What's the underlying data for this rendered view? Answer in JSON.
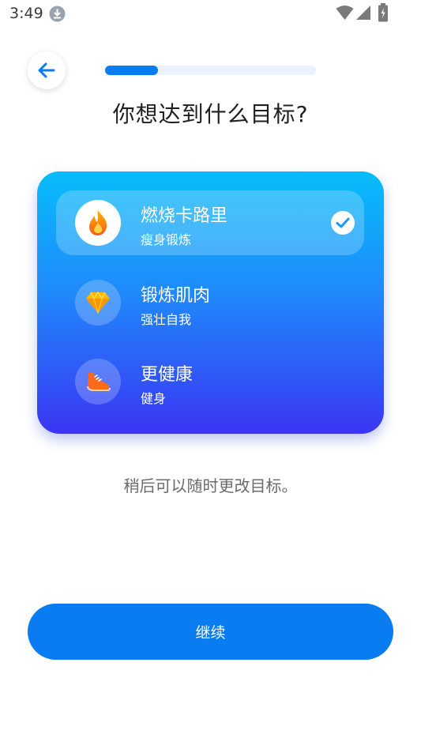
{
  "status_bar": {
    "time": "3:49",
    "icons": [
      "download-icon",
      "wifi-icon",
      "signal-icon",
      "battery-icon"
    ]
  },
  "header": {
    "back_icon": "arrow-left-icon",
    "progress_fraction": 0.25
  },
  "title": "你想达到什么目标?",
  "goals": [
    {
      "title": "燃烧卡路里",
      "subtitle": "瘦身锻炼",
      "icon": "flame-icon",
      "selected": true
    },
    {
      "title": "锻炼肌肉",
      "subtitle": "强壮自我",
      "icon": "diamond-icon",
      "selected": false
    },
    {
      "title": "更健康",
      "subtitle": "健身",
      "icon": "sneaker-icon",
      "selected": false
    }
  ],
  "hint": "稍后可以随时更改目标。",
  "continue_label": "继续",
  "colors": {
    "accent": "#0a7cf2",
    "card_gradient_top": "#07bdfa",
    "card_gradient_bottom": "#3a35f3",
    "check": "#1a9bfa"
  }
}
